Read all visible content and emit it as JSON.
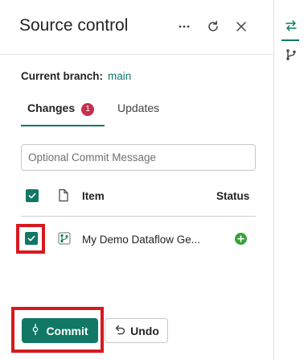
{
  "panel": {
    "title": "Source control",
    "more_icon": "more-horizontal-icon",
    "refresh_icon": "refresh-icon",
    "close_icon": "close-icon"
  },
  "branch": {
    "label": "Current branch:",
    "name": "main"
  },
  "tabs": [
    {
      "label": "Changes",
      "badge": "1",
      "active": true
    },
    {
      "label": "Updates",
      "active": false
    }
  ],
  "commit_message": {
    "placeholder": "Optional Commit Message",
    "value": ""
  },
  "table": {
    "headers": {
      "item": "Item",
      "status": "Status"
    },
    "select_all_checked": true,
    "rows": [
      {
        "checked": true,
        "icon": "dataflow-icon",
        "name": "My Demo Dataflow Ge...",
        "status_icon": "add-status-icon"
      }
    ]
  },
  "actions": {
    "commit_label": "Commit",
    "undo_label": "Undo"
  },
  "rail": {
    "items": [
      {
        "icon": "swap-arrows-icon",
        "active": true
      },
      {
        "icon": "branch-icon",
        "active": false
      }
    ]
  },
  "colors": {
    "accent": "#117865",
    "badge": "#c4314b",
    "status_add": "#3aa13a",
    "highlight": "#d7191f"
  }
}
